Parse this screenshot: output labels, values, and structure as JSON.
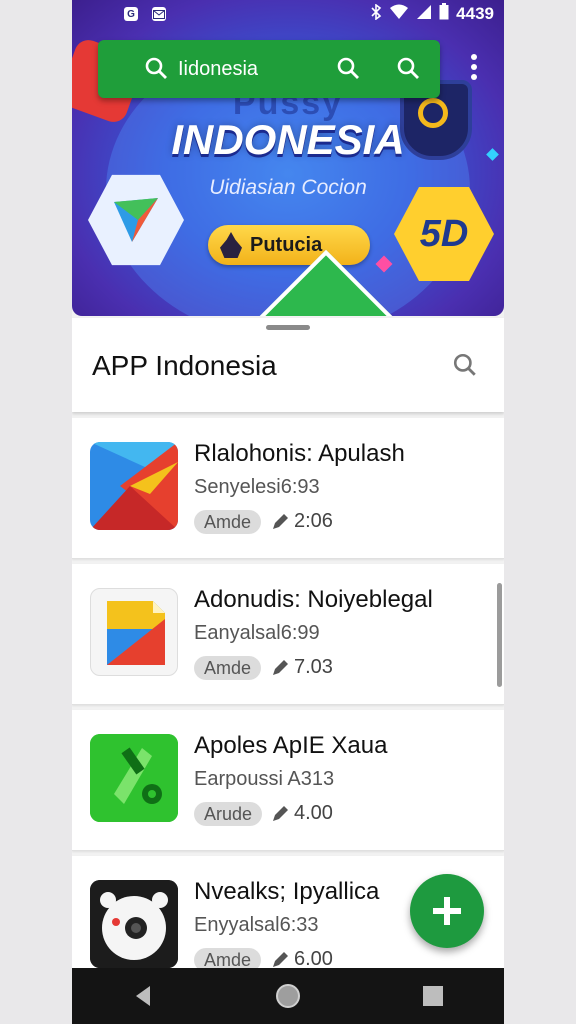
{
  "status_bar": {
    "left_icons": [
      "G",
      "mail"
    ],
    "time": "4439"
  },
  "banner": {
    "ghost_text": "Pussy",
    "title": "INDONESIA",
    "subtitle": "Uidiasian Cocion",
    "pill_label": "Putucia",
    "badge_text": "5D"
  },
  "search": {
    "query": "Iidonesia"
  },
  "section": {
    "title": "APP Indonesia"
  },
  "apps": [
    {
      "title": "Rlalohonis: Apulash",
      "subtitle": "Senyelesi6:93",
      "badge": "Amde",
      "rating": "2:06",
      "icon": "colorful-arrow-icon"
    },
    {
      "title": "Adonudis: Noiyeblegal",
      "subtitle": "Eanyalsal6:99",
      "badge": "Amde",
      "rating": "7.03",
      "icon": "document-icon"
    },
    {
      "title": "Apoles ApIE Xaua",
      "subtitle": "Earpoussi A313",
      "badge": "Arude",
      "rating": "4.00",
      "icon": "tools-icon"
    },
    {
      "title": "Nvealks; Ipyallica",
      "subtitle": "Enyyalsal6:33",
      "badge": "Amde",
      "rating": "6.00",
      "icon": "camera-icon"
    }
  ],
  "colors": {
    "accent_green": "#1f9e3a",
    "banner_blue": "#3657d6",
    "badge_yellow": "#ffcf2e"
  }
}
